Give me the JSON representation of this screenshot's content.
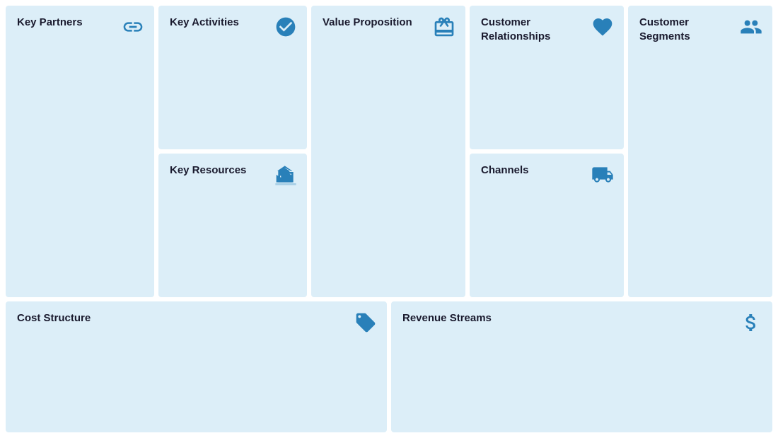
{
  "cells": {
    "key_partners": {
      "title": "Key\nPartners",
      "icon": "link"
    },
    "key_activities": {
      "title": "Key\nActivities",
      "icon": "check"
    },
    "key_resources": {
      "title": "Key\nResources",
      "icon": "factory"
    },
    "value_proposition": {
      "title": "Value\nProposition",
      "icon": "gift"
    },
    "customer_relationships": {
      "title": "Customer\nRelationships",
      "icon": "heart"
    },
    "channels": {
      "title": "Channels",
      "icon": "truck"
    },
    "customer_segments": {
      "title": "Customer\nSegments",
      "icon": "group"
    },
    "cost_structure": {
      "title": "Cost Structure",
      "icon": "tag"
    },
    "revenue_streams": {
      "title": "Revenue Streams",
      "icon": "money"
    }
  }
}
